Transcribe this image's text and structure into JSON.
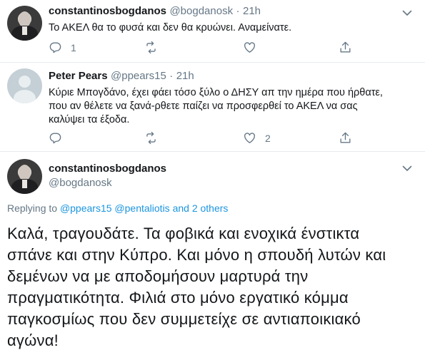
{
  "tweets": [
    {
      "name": "constantinosbogdanos",
      "handle": "@bogdanosk",
      "sep": "·",
      "time": "21h",
      "text": "Το ΑΚΕΛ θα το φυσά και δεν θα κρυώνει. Αναμείνατε.",
      "reply_count": "1",
      "retweet_count": "",
      "like_count": ""
    },
    {
      "name": "Peter Pears",
      "handle": "@ppears15",
      "sep": "·",
      "time": "21h",
      "lines": [
        "Κύριε Μπογδάνο, έχει φάει τόσο ξύλο ο ΔΗΣΥ απ την ημέρα που ήρθατε,",
        "που αν θέλετε να ξανά-ρθετε παίζει να προσφερθεί το ΑΚΕΛ να σας",
        "καλύψει τα έξοδα."
      ],
      "reply_count": "",
      "retweet_count": "",
      "like_count": "2"
    }
  ],
  "main_tweet": {
    "name": "constantinosbogdanos",
    "handle": "@bogdanosk",
    "replying_prefix": "Replying to",
    "replying_user1": "@ppears15",
    "replying_user2": "@pentaliotis",
    "replying_others": "and 2 others",
    "lines": [
      "Καλά, τραγουδάτε. Τα φοβικά και ενοχικά ένστικτα",
      "σπάνε και στην Κύπρο. Και μόνο η σπουδή λυτών και",
      "δεμένων να με αποδομήσουν μαρτυρά την",
      "πραγματικότητα. Φιλιά στο μόνο εργατικό κόμμα",
      "παγκοσμίως που δεν συμμετείχε σε αντιαποικιακό",
      "αγώνα!"
    ]
  },
  "icons": [
    "avatar",
    "caret-down-icon",
    "reply-icon",
    "retweet-icon",
    "like-icon",
    "share-icon"
  ],
  "colors": {
    "text": "#14171a",
    "muted": "#657786",
    "link": "#1b95e0",
    "line": "#ccd6dd"
  }
}
